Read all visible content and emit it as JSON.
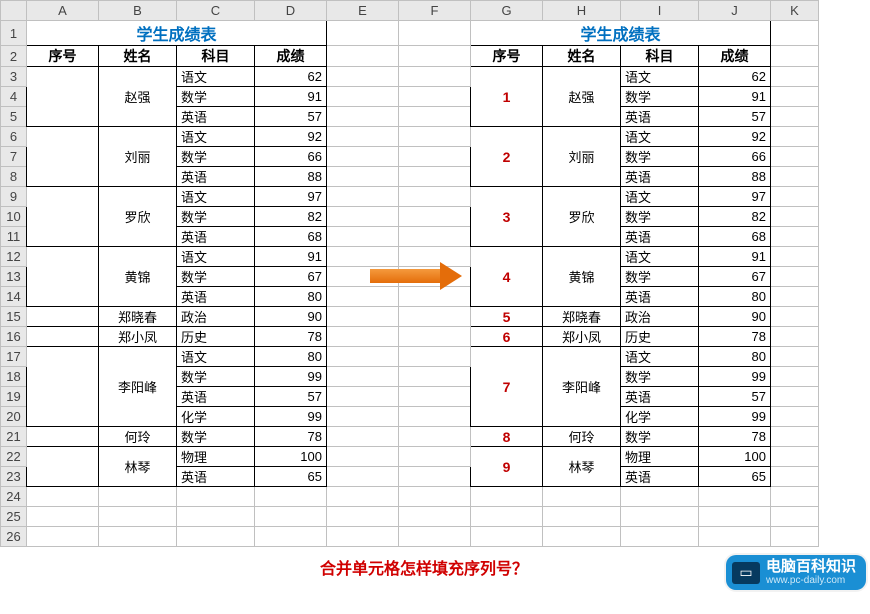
{
  "columns": [
    "A",
    "B",
    "C",
    "D",
    "E",
    "F",
    "G",
    "H",
    "I",
    "J",
    "K"
  ],
  "rowCount": 26,
  "title": "学生成绩表",
  "headers": {
    "seq": "序号",
    "name": "姓名",
    "subject": "科目",
    "score": "成绩"
  },
  "left": {
    "groups": [
      {
        "name": "赵强",
        "rows": [
          {
            "subject": "语文",
            "score": 62
          },
          {
            "subject": "数学",
            "score": 91
          },
          {
            "subject": "英语",
            "score": 57
          }
        ]
      },
      {
        "name": "刘丽",
        "rows": [
          {
            "subject": "语文",
            "score": 92
          },
          {
            "subject": "数学",
            "score": 66
          },
          {
            "subject": "英语",
            "score": 88
          }
        ]
      },
      {
        "name": "罗欣",
        "rows": [
          {
            "subject": "语文",
            "score": 97
          },
          {
            "subject": "数学",
            "score": 82
          },
          {
            "subject": "英语",
            "score": 68
          }
        ]
      },
      {
        "name": "黄锦",
        "rows": [
          {
            "subject": "语文",
            "score": 91
          },
          {
            "subject": "数学",
            "score": 67
          },
          {
            "subject": "英语",
            "score": 80
          }
        ]
      },
      {
        "name": "郑晓春",
        "rows": [
          {
            "subject": "政治",
            "score": 90
          }
        ]
      },
      {
        "name": "郑小凤",
        "rows": [
          {
            "subject": "历史",
            "score": 78
          }
        ]
      },
      {
        "name": "李阳峰",
        "rows": [
          {
            "subject": "语文",
            "score": 80
          },
          {
            "subject": "数学",
            "score": 99
          },
          {
            "subject": "英语",
            "score": 57
          },
          {
            "subject": "化学",
            "score": 99
          }
        ]
      },
      {
        "name": "何玲",
        "rows": [
          {
            "subject": "数学",
            "score": 78
          }
        ]
      },
      {
        "name": "林琴",
        "rows": [
          {
            "subject": "物理",
            "score": 100
          },
          {
            "subject": "英语",
            "score": 65
          }
        ]
      }
    ]
  },
  "right": {
    "groups": [
      {
        "seq": 1,
        "name": "赵强",
        "rows": [
          {
            "subject": "语文",
            "score": 62
          },
          {
            "subject": "数学",
            "score": 91
          },
          {
            "subject": "英语",
            "score": 57
          }
        ]
      },
      {
        "seq": 2,
        "name": "刘丽",
        "rows": [
          {
            "subject": "语文",
            "score": 92
          },
          {
            "subject": "数学",
            "score": 66
          },
          {
            "subject": "英语",
            "score": 88
          }
        ]
      },
      {
        "seq": 3,
        "name": "罗欣",
        "rows": [
          {
            "subject": "语文",
            "score": 97
          },
          {
            "subject": "数学",
            "score": 82
          },
          {
            "subject": "英语",
            "score": 68
          }
        ]
      },
      {
        "seq": 4,
        "name": "黄锦",
        "rows": [
          {
            "subject": "语文",
            "score": 91
          },
          {
            "subject": "数学",
            "score": 67
          },
          {
            "subject": "英语",
            "score": 80
          }
        ]
      },
      {
        "seq": 5,
        "name": "郑晓春",
        "rows": [
          {
            "subject": "政治",
            "score": 90
          }
        ]
      },
      {
        "seq": 6,
        "name": "郑小凤",
        "rows": [
          {
            "subject": "历史",
            "score": 78
          }
        ]
      },
      {
        "seq": 7,
        "name": "李阳峰",
        "rows": [
          {
            "subject": "语文",
            "score": 80
          },
          {
            "subject": "数学",
            "score": 99
          },
          {
            "subject": "英语",
            "score": 57
          },
          {
            "subject": "化学",
            "score": 99
          }
        ]
      },
      {
        "seq": 8,
        "name": "何玲",
        "rows": [
          {
            "subject": "数学",
            "score": 78
          }
        ]
      },
      {
        "seq": 9,
        "name": "林琴",
        "rows": [
          {
            "subject": "物理",
            "score": 100
          },
          {
            "subject": "英语",
            "score": 65
          }
        ]
      }
    ]
  },
  "question": "合并单元格怎样填充序列号？",
  "badge": {
    "title": "电脑百科知识",
    "url": "www.pc-daily.com"
  }
}
